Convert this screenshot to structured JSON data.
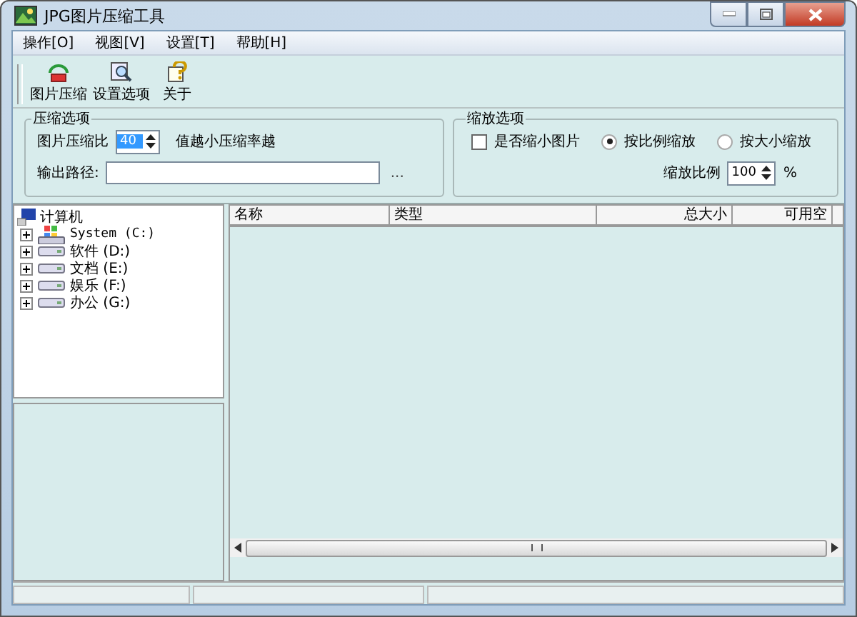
{
  "window": {
    "title": "JPG图片压缩工具"
  },
  "menu": [
    {
      "label": "操作[O]"
    },
    {
      "label": "视图[V]"
    },
    {
      "label": "设置[T]"
    },
    {
      "label": "帮助[H]"
    }
  ],
  "toolbar": [
    {
      "label": "图片压缩",
      "kind": "compress"
    },
    {
      "label": "设置选项",
      "kind": "settings"
    },
    {
      "label": "关于",
      "kind": "about"
    }
  ],
  "compression": {
    "title": "压缩选项",
    "ratio_label": "图片压缩比",
    "ratio_value": "40",
    "hint": "值越小压缩率越",
    "output_label": "输出路径:",
    "browse": "..."
  },
  "scaling": {
    "title": "缩放选项",
    "shrink": {
      "label": "是否缩小图片",
      "checked": false
    },
    "modes": [
      {
        "label": "按比例缩放",
        "selected": true
      },
      {
        "label": "按大小缩放",
        "selected": false
      }
    ],
    "ratio_label": "缩放比例",
    "ratio_value": "100",
    "unit": "%"
  },
  "tree": {
    "label": "计算机",
    "children": [
      {
        "label": "System (C:)",
        "kind": "system"
      },
      {
        "label": "软件 (D:)",
        "kind": "drive"
      },
      {
        "label": "文档 (E:)",
        "kind": "drive"
      },
      {
        "label": "娱乐 (F:)",
        "kind": "drive"
      },
      {
        "label": "办公 (G:)",
        "kind": "drive"
      }
    ]
  },
  "table": {
    "columns": [
      {
        "label": "名称",
        "kind": "text"
      },
      {
        "label": "类型",
        "kind": "text"
      },
      {
        "label": "总大小",
        "kind": "number"
      },
      {
        "label": "可用空",
        "kind": "number"
      }
    ]
  }
}
